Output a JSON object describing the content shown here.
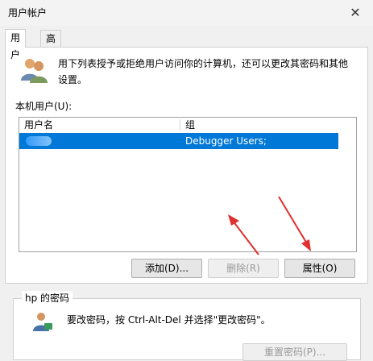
{
  "window": {
    "title": "用户帐户",
    "close_glyph": "✕"
  },
  "tabs": [
    {
      "label": "用户"
    },
    {
      "label": "高级"
    }
  ],
  "info": {
    "text": "用下列表授予或拒绝用户访问你的计算机，还可以更改其密码和其他设置。"
  },
  "local_users": {
    "label": "本机用户(U):",
    "columns": [
      "用户名",
      "组"
    ],
    "rows": [
      {
        "username": "",
        "group": "Debugger Users; Administrators",
        "selected": true
      }
    ]
  },
  "buttons": {
    "add": "添加(D)...",
    "remove": "删除(R)",
    "properties": "属性(O)"
  },
  "password_group": {
    "title": "hp 的密码",
    "text": "要改密码，按 Ctrl-Alt-Del 并选择\"更改密码\"。",
    "reset_button": "重置密码(P)..."
  },
  "colors": {
    "selection": "#0078d7",
    "annotation_arrow": "#e03030"
  }
}
